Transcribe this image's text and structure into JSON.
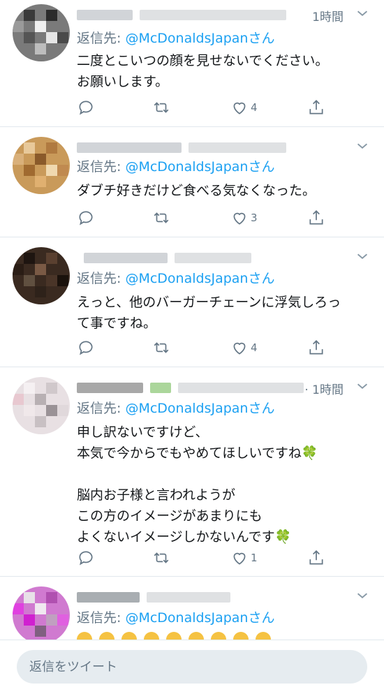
{
  "colors": {
    "accent": "#1da1f2",
    "secondary_text": "#657786",
    "divider": "#e1e8ed",
    "like_icon": "#657786"
  },
  "tweets": [
    {
      "time": "1時間",
      "reply_prefix": "返信先: ",
      "reply_handle": "@McDonaldsJapan",
      "reply_suffix": "さん",
      "text": "二度とこいつの顔を見せないでください。\nお願いします。",
      "like_count": "4"
    },
    {
      "time": "",
      "reply_prefix": "返信先: ",
      "reply_handle": "@McDonaldsJapan",
      "reply_suffix": "さん",
      "text": "ダブチ好きだけど食べる気なくなった。",
      "like_count": "3"
    },
    {
      "time": "",
      "reply_prefix": "返信先: ",
      "reply_handle": "@McDonaldsJapan",
      "reply_suffix": "さん",
      "text": "えっと、他のバーガーチェーンに浮気しろっ\nて事ですね。",
      "like_count": "4"
    },
    {
      "time": "· 1時間",
      "reply_prefix": "返信先: ",
      "reply_handle": "@McDonaldsJapan",
      "reply_suffix": "さん",
      "text": "申し訳ないですけど、\n本気で今からでもやめてほしいですね🍀\n\n脳内お子様と言われようが\nこの方のイメージがあまりにも\nよくないイメージしかないんです🍀",
      "like_count": "1"
    },
    {
      "time": "",
      "reply_prefix": "返信先: ",
      "reply_handle": "@McDonaldsJapan",
      "reply_suffix": "さん",
      "text": "",
      "like_count": ""
    }
  ],
  "compose": {
    "placeholder": "返信をツイート"
  },
  "icons": [
    "reply-icon",
    "retweet-icon",
    "like-icon",
    "share-icon",
    "chevron-down-icon"
  ]
}
